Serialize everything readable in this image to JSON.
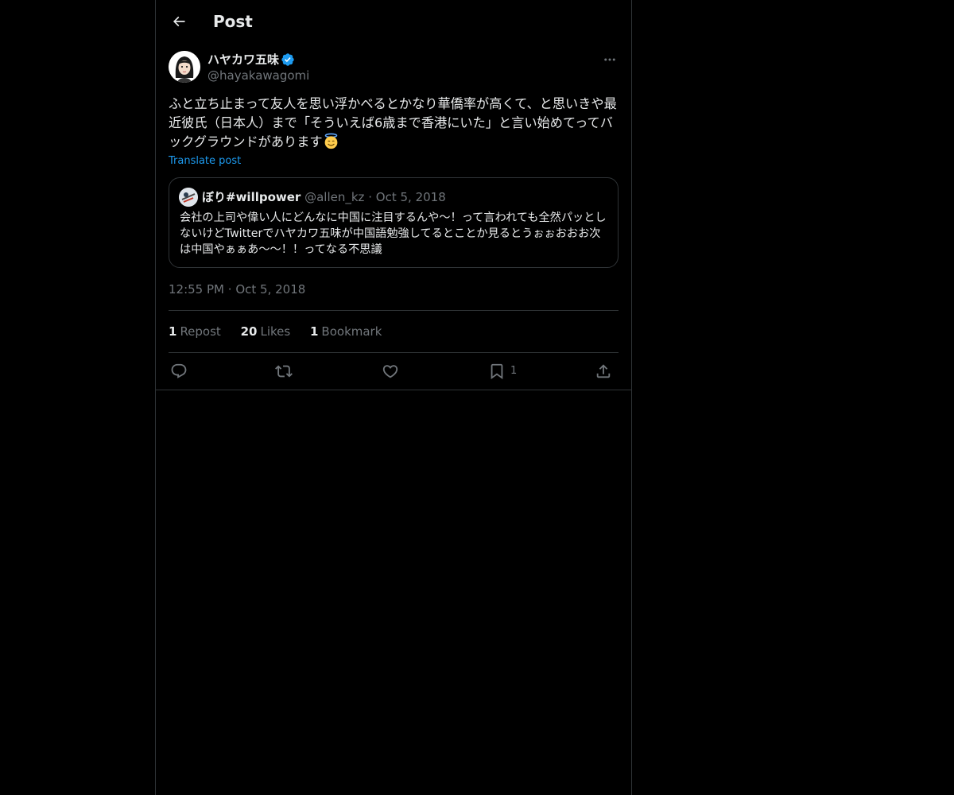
{
  "header": {
    "title": "Post",
    "back_icon": "arrow-left-icon"
  },
  "post": {
    "author": {
      "display_name": "ハヤカワ五味",
      "handle": "@hayakawagomi",
      "verified": true,
      "verified_icon": "verified-badge-icon"
    },
    "more_icon": "more-horizontal-icon",
    "text": "ふと立ち止まって友人を思い浮かべるとかなり華僑率が高くて、と思いきや最近彼氏（日本人）まで「そういえば6歳まで香港にいた」と言い始めてってバックグラウンドがあります",
    "emoji": "smiling-face-with-halo",
    "translate_label": "Translate post",
    "quote": {
      "display_name": "ぼり#willpower",
      "handle": "@allen_kz",
      "separator": "·",
      "date": "Oct 5, 2018",
      "text": "会社の上司や偉い人にどんなに中国に注目するんや〜！って言われても全然パッとしないけどTwitterでハヤカワ五味が中国語勉強してるとことか見るとうぉぉおおお次は中国やぁぁあ〜〜！！ってなる不思議"
    },
    "timestamp": {
      "time": "12:55 PM",
      "separator": "·",
      "date": "Oct 5, 2018"
    },
    "stats": {
      "reposts": {
        "count": "1",
        "label": "Repost"
      },
      "likes": {
        "count": "20",
        "label": "Likes"
      },
      "bookmarks": {
        "count": "1",
        "label": "Bookmark"
      }
    },
    "actions": {
      "reply_icon": "reply-icon",
      "repost_icon": "repost-icon",
      "like_icon": "heart-icon",
      "bookmark_icon": "bookmark-icon",
      "bookmark_count": "1",
      "share_icon": "share-icon"
    }
  },
  "colors": {
    "background": "#000000",
    "text_primary": "#e7e9ea",
    "text_secondary": "#71767b",
    "accent": "#1d9bf0",
    "border": "#2f3336"
  }
}
